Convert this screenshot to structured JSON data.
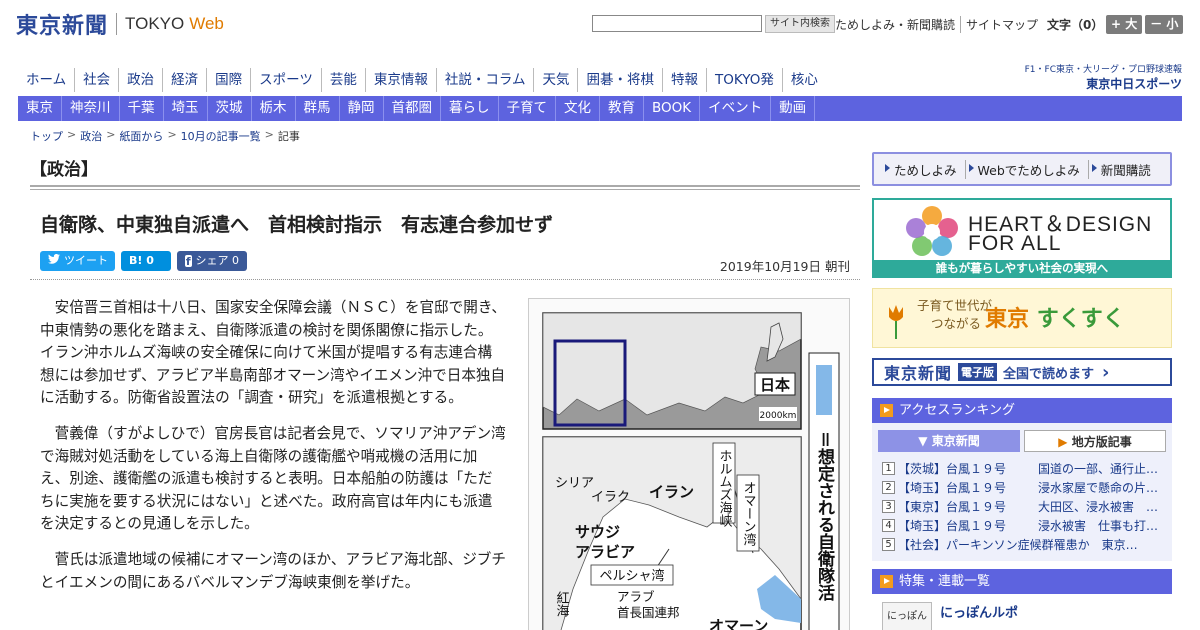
{
  "header": {
    "logo_main": "東京新聞",
    "logo_tokyo": "TOKYO",
    "logo_web": "Web",
    "search_button": "サイト内検索",
    "top_links": [
      "ためしよみ・新聞購読",
      "サイトマップ"
    ],
    "fontsize_label": "文字（0）",
    "font_larger": "+ 大",
    "font_smaller": "－ 小"
  },
  "main_nav": [
    "ホーム",
    "社会",
    "政治",
    "経済",
    "国際",
    "スポーツ",
    "芸能",
    "東京情報",
    "社説・コラム",
    "天気",
    "囲碁・将棋",
    "特報",
    "TOKYO発",
    "核心"
  ],
  "sports_logo": {
    "line1": "F1・FC東京・大リーグ・プロ野球速報",
    "line2": "東京中日スポーツ"
  },
  "region_nav": [
    "東京",
    "神奈川",
    "千葉",
    "埼玉",
    "茨城",
    "栃木",
    "群馬",
    "静岡",
    "首都圏",
    "暮らし",
    "子育て",
    "文化",
    "教育",
    "BOOK",
    "イベント",
    "動画"
  ],
  "breadcrumb": [
    "トップ",
    "政治",
    "紙面から",
    "10月の記事一覧",
    "記事"
  ],
  "article": {
    "section": "【政治】",
    "headline": "自衛隊、中東独自派遣へ　首相検討指示　有志連合参加せず",
    "share": {
      "tweet": "ツイート",
      "hatena": "B! 0",
      "facebook": "シェア 0"
    },
    "date": "2019年10月19日 朝刊",
    "paragraphs": [
      "安倍晋三首相は十八日、国家安全保障会議（ＮＳＣ）を官邸で開き、中東情勢の悪化を踏まえ、自衛隊派遣の検討を関係閣僚に指示した。イラン沖ホルムズ海峡の安全確保に向けて米国が提唱する有志連合構想には参加せず、アラビア半島南部オマーン湾やイエメン沖で日本独自に活動する。防衛省設置法の「調査・研究」を派遣根拠とする。",
      "菅義偉（すがよしひで）官房長官は記者会見で、ソマリア沖アデン湾で海賊対処活動をしている海上自衛隊の護衛艦や哨戒機の活用に加え、別途、護衛艦の派遣も検討すると表明。日本船舶の防護は「ただちに実施を要する状況にはない」と述べた。政府高官は年内にも派遣を決定するとの見通しを示した。",
      "菅氏は派遣地域の候補にオマーン湾のほか、アラビア海北部、ジブチとイエメンの間にあるバベルマンデブ海峡東側を挙げた。"
    ]
  },
  "figure": {
    "japan_label": "日本",
    "scale_label": "2000km",
    "legend_text": "＝想定される自衛隊活",
    "labels": {
      "syria": "シリア",
      "iraq": "イラク",
      "iran": "イラン",
      "saudi": "サウジアラビア",
      "saudi_1": "サウジ",
      "saudi_2": "アラビア",
      "hormuz": "ホルムズ海峡",
      "oman_gulf": "オマーン湾",
      "persian_gulf": "ペルシャ湾",
      "uae_1": "アラブ",
      "uae_2": "首長国連邦",
      "red_sea": "紅海",
      "oman": "オマーン"
    }
  },
  "sidebar": {
    "trial_links": [
      "ためしよみ",
      "Webでためしよみ",
      "新聞購読"
    ],
    "heart_title1": "HEART＆DESIGN",
    "heart_title2": "FOR ALL",
    "heart_sub": "誰もが暮らしやすい社会の実現へ",
    "suku_small_1": "子育て世代が",
    "suku_small_2": "つながる",
    "suku_brand_1": "東京",
    "suku_brand_2": "すくすく",
    "epaper_logo": "東京新聞",
    "epaper_tag": "電子版",
    "epaper_text": "全国で読めます",
    "ranking_head": "アクセスランキング",
    "ranking_tabs": [
      "東京新聞",
      "地方版記事"
    ],
    "ranking": [
      {
        "num": "1",
        "left": "【茨城】台風１９号",
        "right": "国道の一部、通行止…"
      },
      {
        "num": "2",
        "left": "【埼玉】台風１９号",
        "right": "浸水家屋で懸命の片…"
      },
      {
        "num": "3",
        "left": "【東京】台風１９号",
        "right": "大田区、浸水被害　…"
      },
      {
        "num": "4",
        "left": "【埼玉】台風１９号",
        "right": "浸水被害　仕事も打…"
      },
      {
        "num": "5",
        "left": "【社会】パーキンソン症候群罹患か　東京…",
        "right": ""
      }
    ],
    "special_head": "特集・連載一覧",
    "nippon_thumb": "にっぽん",
    "nippon_title": "にっぽんルポ"
  },
  "colors": {
    "brand_blue": "#2c4a9a",
    "nav_bar": "#5d63df",
    "web_orange": "#e07b00",
    "heart_teal": "#2eaa9a",
    "twitter": "#1da1f2",
    "hatena": "#008fde",
    "facebook": "#3b5998"
  }
}
